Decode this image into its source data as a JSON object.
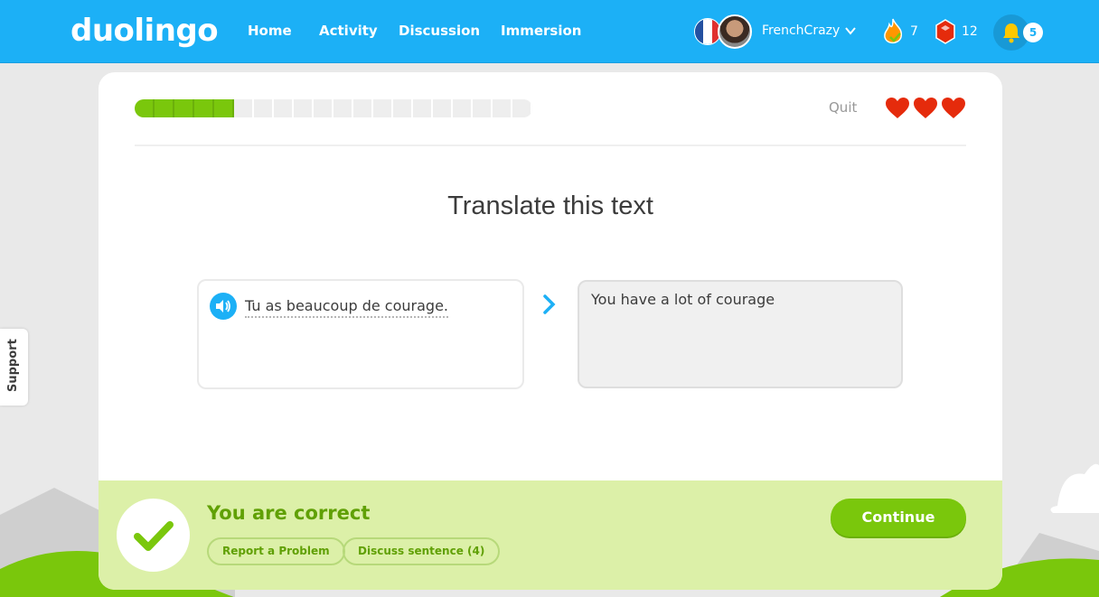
{
  "nav": {
    "logo": "duolingo",
    "links": [
      "Home",
      "Activity",
      "Discussion",
      "Immersion"
    ],
    "username": "FrenchCrazy",
    "streak": "7",
    "gems": "12",
    "notifications": "5"
  },
  "lesson": {
    "progress_fraction": 0.25,
    "quit_label": "Quit",
    "hearts": 3,
    "title": "Translate this text",
    "source_sentence": "Tu as beaucoup de courage.",
    "answer": "You have a lot of courage"
  },
  "feedback": {
    "status": "You are correct",
    "report_label": "Report a Problem",
    "discuss_label": "Discuss sentence (4)",
    "continue_label": "Continue"
  },
  "support_label": "Support",
  "colors": {
    "brand_blue": "#1cb0f6",
    "success_green": "#7ac70c",
    "success_bg": "#dcf0a8",
    "heart_red": "#e52b0c"
  }
}
